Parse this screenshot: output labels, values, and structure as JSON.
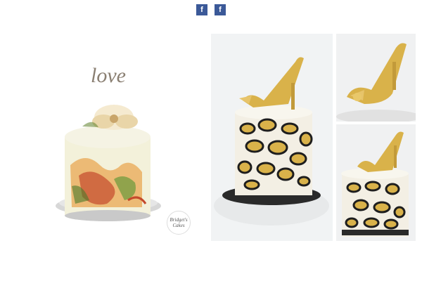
{
  "share_buttons": [
    {
      "label": "f",
      "icon": "facebook-icon"
    },
    {
      "label": "f",
      "icon": "facebook-icon"
    }
  ],
  "photos": [
    {
      "alt": "Hand-painted floral cake with love topper",
      "topper_text": "love",
      "watermark": [
        "Bridget's",
        "Cakes"
      ]
    },
    {
      "alt": "Leopard print cake with gold stiletto shoe"
    },
    {
      "alt": "Gold stiletto shoe close-up"
    },
    {
      "alt": "Leopard print cake side view"
    }
  ],
  "colors": {
    "facebook": "#3b5998",
    "gold": "#d9b24a",
    "cream": "#f5ead0"
  }
}
